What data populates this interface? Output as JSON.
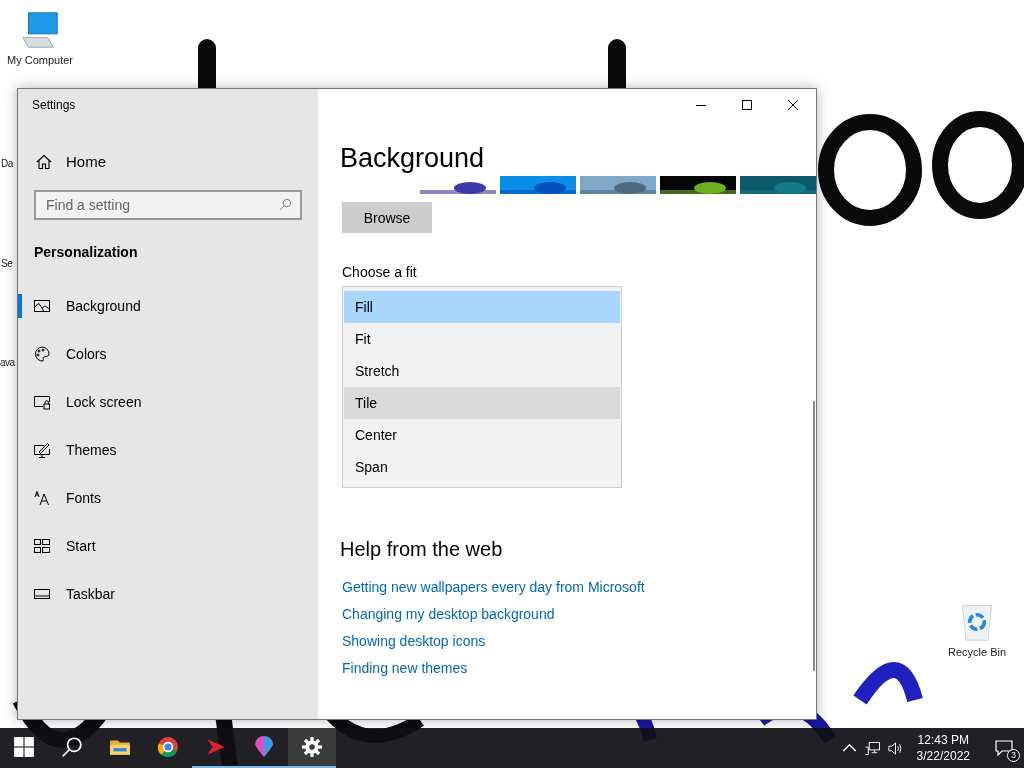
{
  "desktop_icons": [
    {
      "label": "My Computer"
    },
    {
      "label": "Da"
    },
    {
      "label": "Se"
    },
    {
      "label": "ava"
    },
    {
      "label": "Recycle Bin"
    }
  ],
  "window": {
    "title": "Settings"
  },
  "sidebar": {
    "home": "Home",
    "search": {
      "placeholder": "Find a setting"
    },
    "section": "Personalization",
    "items": [
      {
        "label": "Background",
        "selected": true
      },
      {
        "label": "Colors",
        "selected": false
      },
      {
        "label": "Lock screen",
        "selected": false
      },
      {
        "label": "Themes",
        "selected": false
      },
      {
        "label": "Fonts",
        "selected": false
      },
      {
        "label": "Start",
        "selected": false
      },
      {
        "label": "Taskbar",
        "selected": false
      }
    ]
  },
  "content": {
    "heading": "Background",
    "thumbnails": [
      {
        "kind": "picture"
      },
      {
        "kind": "picture"
      },
      {
        "kind": "picture"
      },
      {
        "kind": "picture"
      },
      {
        "kind": "picture"
      }
    ],
    "browse_button": "Browse",
    "fit_label": "Choose a fit",
    "fit_options": [
      {
        "label": "Fill",
        "selected": true,
        "hovered": false
      },
      {
        "label": "Fit",
        "selected": false,
        "hovered": false
      },
      {
        "label": "Stretch",
        "selected": false,
        "hovered": false
      },
      {
        "label": "Tile",
        "selected": false,
        "hovered": true
      },
      {
        "label": "Center",
        "selected": false,
        "hovered": false
      },
      {
        "label": "Span",
        "selected": false,
        "hovered": false
      }
    ],
    "help_heading": "Help from the web",
    "links": [
      "Getting new wallpapers every day from Microsoft",
      "Changing my desktop background",
      "Showing desktop icons",
      "Finding new themes"
    ]
  },
  "taskbar": {
    "apps": [
      {
        "running": false,
        "selected": false
      },
      {
        "running": false,
        "selected": false
      },
      {
        "running": false,
        "selected": false
      },
      {
        "running": false,
        "selected": false
      },
      {
        "running": true,
        "selected": false
      },
      {
        "running": true,
        "selected": false
      },
      {
        "running": true,
        "selected": true
      }
    ],
    "time": "12:43 PM",
    "date": "3/22/2022",
    "notification_count": "3"
  }
}
